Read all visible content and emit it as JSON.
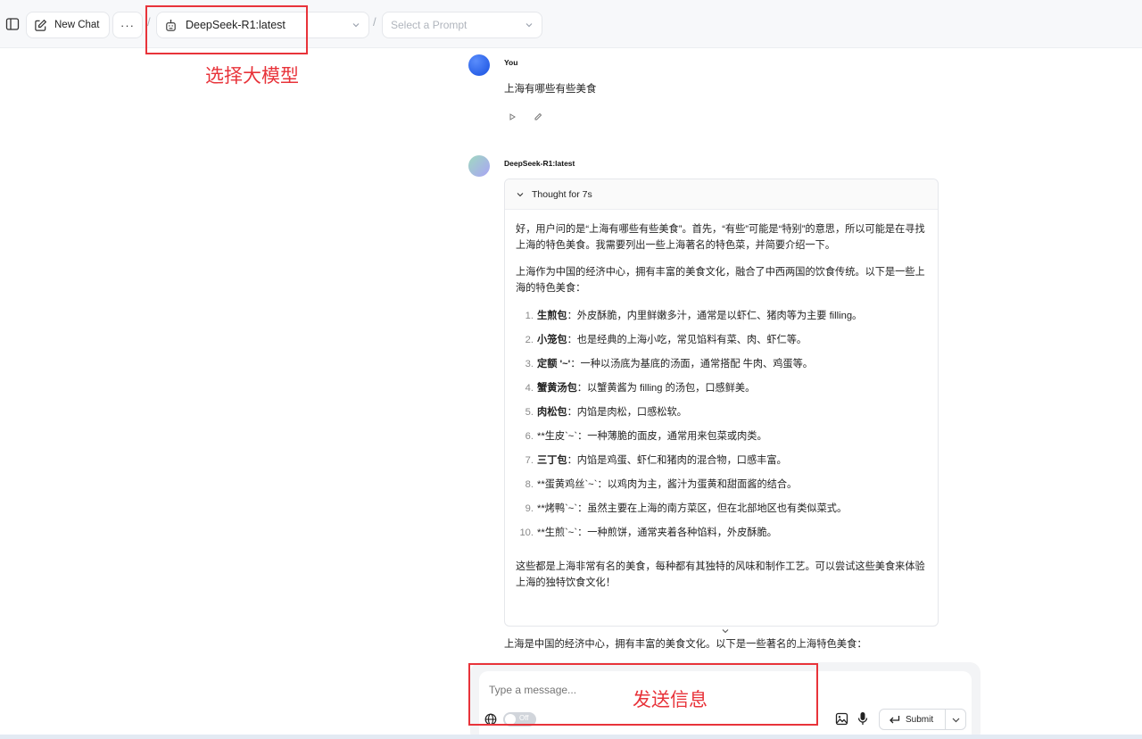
{
  "topbar": {
    "new_chat_label": "New Chat",
    "more_label": "···",
    "separator": "/",
    "model_name": "DeepSeek-R1:latest",
    "prompt_placeholder": "Select a Prompt"
  },
  "annotations": {
    "model_label": "选择大模型",
    "send_label": "发送信息",
    "color": "#e8333a"
  },
  "messages": {
    "user_name": "You",
    "user_text": "上海有哪些有些美食",
    "bot_name": "DeepSeek-R1:latest",
    "thought_label": "Thought for 7s",
    "thought_p1": "好，用户问的是“上海有哪些有些美食”。首先，“有些”可能是“特别”的意思，所以可能是在寻找上海的特色美食。我需要列出一些上海著名的特色菜，并简要介绍一下。",
    "thought_p2": "上海作为中国的经济中心，拥有丰富的美食文化，融合了中西两国的饮食传统。以下是一些上海的特色美食：",
    "list": [
      {
        "num": "1.",
        "title": "生煎包",
        "desc": "：外皮酥脆，内里鲜嫩多汁，通常是以虾仁、猪肉等为主要 filling。"
      },
      {
        "num": "2.",
        "title": "小笼包",
        "desc": "：也是经典的上海小吃，常见馅料有菜、肉、虾仁等。"
      },
      {
        "num": "3.",
        "title": "定额 '~'",
        "desc": "：一种以汤底为基底的汤面，通常搭配 牛肉、鸡蛋等。"
      },
      {
        "num": "4.",
        "title": "蟹黄汤包",
        "desc": "：以蟹黄酱为 filling 的汤包，口感鲜美。"
      },
      {
        "num": "5.",
        "title": "肉松包",
        "desc": "：内馅是肉松，口感松软。"
      },
      {
        "num": "6.",
        "title": "",
        "desc": "**生皮`~`：一种薄脆的面皮，通常用来包菜或肉类。"
      },
      {
        "num": "7.",
        "title": "三丁包",
        "desc": "：内馅是鸡蛋、虾仁和猪肉的混合物，口感丰富。"
      },
      {
        "num": "8.",
        "title": "",
        "desc": "**蛋黄鸡丝`~`：以鸡肉为主，酱汁为蛋黄和甜面酱的结合。"
      },
      {
        "num": "9.",
        "title": "",
        "desc": "**烤鸭`~`：虽然主要在上海的南方菜区，但在北部地区也有类似菜式。"
      },
      {
        "num": "10.",
        "title": "",
        "desc": "**生煎`~`：一种煎饼，通常夹着各种馅料，外皮酥脆。"
      }
    ],
    "thought_p3": "这些都是上海非常有名的美食，每种都有其独特的风味和制作工艺。可以尝试这些美食来体验上海的独特饮食文化！",
    "answer_text": "上海是中国的经济中心，拥有丰富的美食文化。以下是一些著名的上海特色美食："
  },
  "composer": {
    "placeholder": "Type a message...",
    "toggle_label": "Off",
    "submit_label": "Submit"
  }
}
